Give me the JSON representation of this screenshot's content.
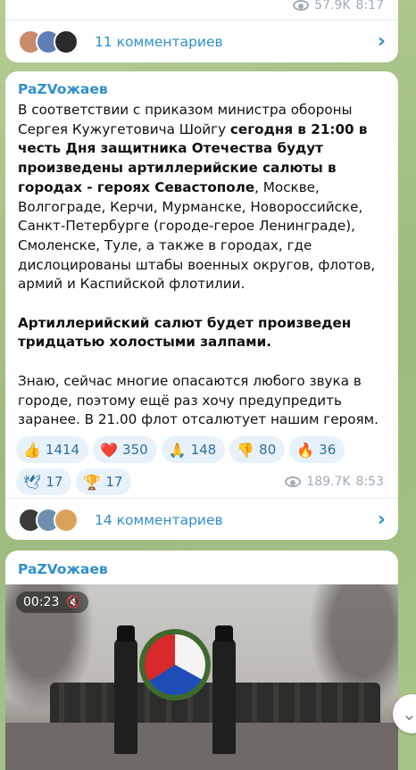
{
  "prev_post": {
    "views": "57.9K",
    "time": "8:17",
    "comments_label": "11 комментариев"
  },
  "main_post": {
    "author": "PaZVoжaeв",
    "text": {
      "p1_a": "В соответствии с приказом министра обороны Сергея Кужугетовича Шойгу ",
      "p1_b": "сегодня в 21:00 в честь Дня защитника Отечества будут произведены артиллерийские салюты в городах - героях Севастополе",
      "p1_c": ", Москве, Волгограде, Керчи, Мурманске, Новороссийске, Санкт-Петербурге (городе-герое Ленинграде), Смоленске, Туле, а также в городах, где дислоцированы штабы военных округов, флотов, армий и Каспийской флотилии.",
      "p2": "Артиллерийский салют будет произведен тридцатью холостыми залпами.",
      "p3": "Знаю, сейчас многие опасаются любого звука в городе, поэтому ещё  раз хочу предупредить заранее. В 21.00 флот отсалютует нашим героям."
    },
    "reactions": [
      {
        "emoji": "👍",
        "count": "1414"
      },
      {
        "emoji": "❤️",
        "count": "350"
      },
      {
        "emoji": "🙏",
        "count": "148"
      },
      {
        "emoji": "👎",
        "count": "80"
      },
      {
        "emoji": "🔥",
        "count": "36"
      },
      {
        "emoji": "🕊",
        "count": "17"
      },
      {
        "emoji": "🏆",
        "count": "17"
      }
    ],
    "views": "189.7K",
    "time": "8:53",
    "comments_label": "14 комментариев"
  },
  "next_post": {
    "author": "PaZVoжaeв",
    "video_time": "00:23",
    "mute_icon": "🔇"
  },
  "colors": {
    "accent": "#2e90cc",
    "reaction_bg": "#e7f1fa",
    "background": "#a9c48a"
  }
}
